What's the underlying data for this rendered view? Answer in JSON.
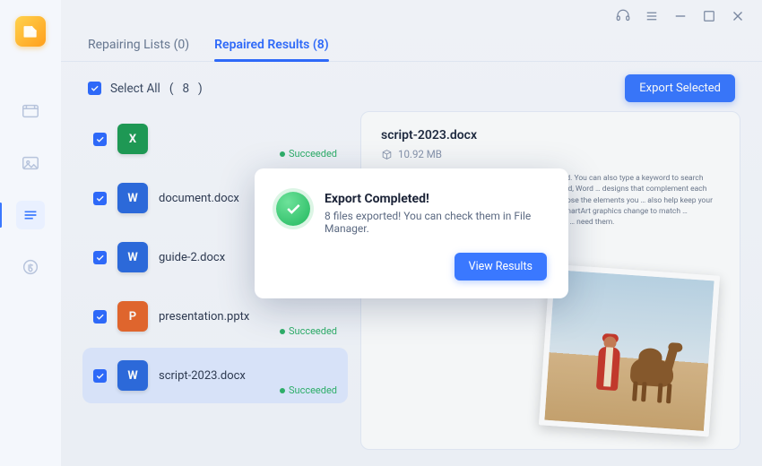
{
  "tabs": {
    "repairing": {
      "label": "Repairing Lists",
      "count": 0
    },
    "repaired": {
      "label": "Repaired Results",
      "count": 8
    }
  },
  "toolbar": {
    "select_all_label": "Select All",
    "select_all_count": 8,
    "export_label": "Export Selected"
  },
  "sidebar": {
    "items": [
      "video",
      "image",
      "document",
      "audio"
    ]
  },
  "files": [
    {
      "name": "",
      "type": "x",
      "status": "Succeeded"
    },
    {
      "name": "document.docx",
      "type": "w",
      "status": ""
    },
    {
      "name": "guide-2.docx",
      "type": "w",
      "status": ""
    },
    {
      "name": "presentation.pptx",
      "type": "p",
      "status": "Succeeded"
    },
    {
      "name": "script-2023.docx",
      "type": "w",
      "status": "Succeeded"
    }
  ],
  "preview": {
    "title": "script-2023.docx",
    "size": "10.92 MB",
    "body": "…your point. When you click Online Video, you can … add. You can also type a keyword to search online for … your document look professionally produced, Word … designs that complement each other. For example, … sidebar. Click Insert and then choose the elements you … also help keep your document coordinated. When … pictures, charts, and SmartArt graphics change to match … headings change to match the new theme. Save time in … need them."
  },
  "dialog": {
    "title": "Export Completed!",
    "message": "8 files exported! You can check them in File Manager.",
    "action": "View Results"
  }
}
